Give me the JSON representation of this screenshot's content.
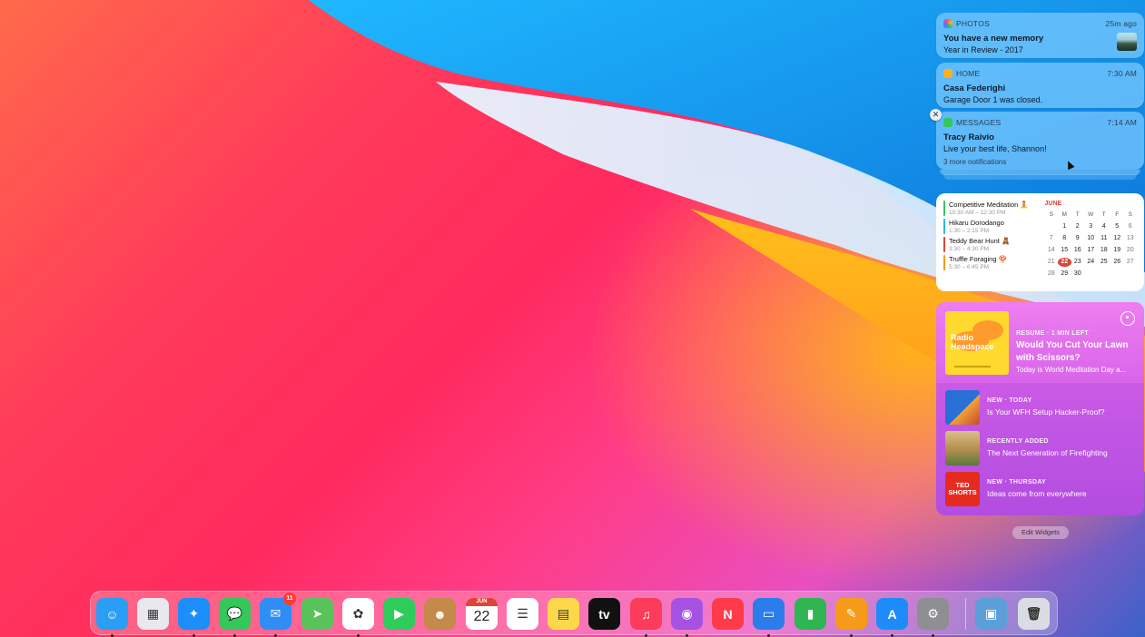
{
  "notifications": [
    {
      "app": "PHOTOS",
      "time": "25m ago",
      "title": "You have a new memory",
      "body": "Year in Review - 2017",
      "icon_color": "#ffb020"
    },
    {
      "app": "HOME",
      "time": "7:30 AM",
      "title": "Casa Federighi",
      "body": "Garage Door 1 was closed.",
      "icon_color": "#ffb020"
    },
    {
      "app": "MESSAGES",
      "time": "7:14 AM",
      "title": "Tracy Raivio",
      "body": "Live your best life, Shannon!",
      "more": "3 more notifications",
      "icon_color": "#34c759"
    }
  ],
  "calendar": {
    "events": [
      {
        "title": "Competitive Meditation 🧘",
        "time": "10:30 AM – 12:30 PM",
        "color": "#34c759"
      },
      {
        "title": "Hikaru Dorodango",
        "time": "1:30 – 2:15 PM",
        "color": "#27b8e8"
      },
      {
        "title": "Teddy Bear Hunt 🧸",
        "time": "3:30 – 4:30 PM",
        "color": "#e0433a"
      },
      {
        "title": "Truffle Foraging 🍄",
        "time": "5:30 – 6:45 PM",
        "color": "#f39c12"
      }
    ],
    "month": "JUNE",
    "weekdays": [
      "S",
      "M",
      "T",
      "W",
      "T",
      "F",
      "S"
    ],
    "weeks": [
      [
        "",
        "1",
        "2",
        "3",
        "4",
        "5",
        "6"
      ],
      [
        "7",
        "8",
        "9",
        "10",
        "11",
        "12",
        "13"
      ],
      [
        "14",
        "15",
        "16",
        "17",
        "18",
        "19",
        "20"
      ],
      [
        "21",
        "22",
        "23",
        "24",
        "25",
        "26",
        "27"
      ],
      [
        "28",
        "29",
        "30",
        "",
        "",
        "",
        ""
      ]
    ],
    "today": "22"
  },
  "podcasts": {
    "featured": {
      "kicker": "RESUME · 1 MIN LEFT",
      "title": "Would You Cut Your Lawn with Scissors?",
      "desc": "Today is World Meditation Day a...",
      "art_text": "Radio Headspace"
    },
    "episodes": [
      {
        "kicker": "NEW · TODAY",
        "title": "Is Your WFH Setup Hacker-Proof?",
        "art": "#2a6fd6"
      },
      {
        "kicker": "RECENTLY ADDED",
        "title": "The Next Generation of Firefighting",
        "art": "#c8a14a"
      },
      {
        "kicker": "NEW · THURSDAY",
        "title": "Ideas come from everywhere",
        "art": "#e62b1e",
        "art_text": "TED SHORTS"
      }
    ]
  },
  "edit_widgets": "Edit Widgets",
  "dock": {
    "apps": [
      {
        "name": "finder",
        "color": "#2a9df4",
        "glyph": "☺"
      },
      {
        "name": "launchpad",
        "color": "#e8e8ee",
        "glyph": "▦"
      },
      {
        "name": "safari",
        "color": "#1c8ef9",
        "glyph": "✦"
      },
      {
        "name": "messages",
        "color": "#34c759",
        "glyph": "💬"
      },
      {
        "name": "mail",
        "color": "#2f8df5",
        "glyph": "✉",
        "badge": "11"
      },
      {
        "name": "maps",
        "color": "#58c25b",
        "glyph": "➤"
      },
      {
        "name": "photos",
        "color": "#ffffff",
        "glyph": "✿"
      },
      {
        "name": "facetime",
        "color": "#2ecc5a",
        "glyph": "▶"
      },
      {
        "name": "contacts",
        "color": "#c48a4c",
        "glyph": "☻"
      },
      {
        "name": "calendar",
        "color": "#ffffff",
        "glyph": "22",
        "label": "JUN"
      },
      {
        "name": "reminders",
        "color": "#ffffff",
        "glyph": "☰"
      },
      {
        "name": "notes",
        "color": "#ffd84a",
        "glyph": "▤"
      },
      {
        "name": "apple-tv",
        "color": "#111111",
        "glyph": "tv"
      },
      {
        "name": "music",
        "color": "#fc3c5a",
        "glyph": "♫"
      },
      {
        "name": "podcasts",
        "color": "#a552e3",
        "glyph": "◉"
      },
      {
        "name": "news",
        "color": "#ff3b4b",
        "glyph": "N"
      },
      {
        "name": "keynote",
        "color": "#2b7de9",
        "glyph": "▭"
      },
      {
        "name": "numbers",
        "color": "#2fb552",
        "glyph": "▮"
      },
      {
        "name": "pages",
        "color": "#f59b19",
        "glyph": "✎"
      },
      {
        "name": "app-store",
        "color": "#1d8cf8",
        "glyph": "A"
      },
      {
        "name": "system-preferences",
        "color": "#8e8e93",
        "glyph": "⚙"
      },
      {
        "name": "downloads-stack",
        "color": "#5b9fd8",
        "glyph": "▣"
      },
      {
        "name": "trash",
        "color": "#d9dde3",
        "glyph": "🗑"
      }
    ]
  }
}
